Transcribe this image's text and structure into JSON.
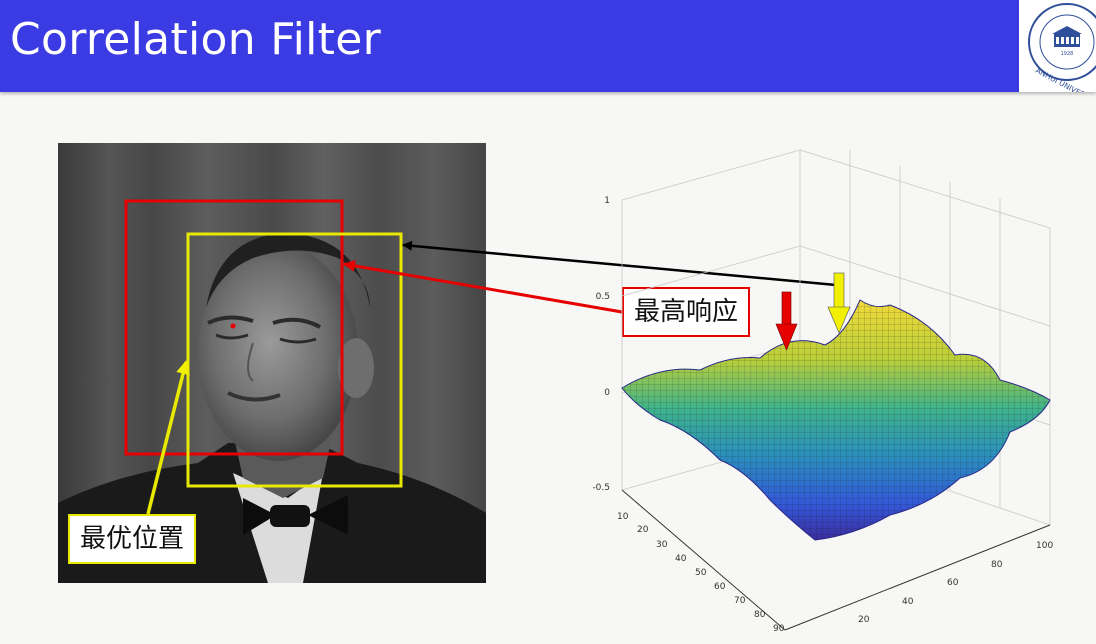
{
  "slide": {
    "title": "Correlation Filter",
    "logo": {
      "icon": "anhui-university-seal",
      "year": "1928",
      "text": "ANHUI UNIVERSITY"
    }
  },
  "annotations": {
    "optimal_position": "最优位置",
    "highest_response": "最高响应"
  },
  "plot": {
    "z_ticks": [
      "1",
      "0.5",
      "0",
      "-0.5"
    ],
    "y_ticks": [
      "10",
      "20",
      "30",
      "40",
      "50",
      "60",
      "70",
      "80",
      "90"
    ],
    "x_ticks": [
      "20",
      "40",
      "60",
      "80",
      "100"
    ]
  },
  "colors": {
    "header": "#3b3be3",
    "box_red": "#e60000",
    "box_yellow": "#e8e800",
    "arrow_black": "#000000"
  }
}
